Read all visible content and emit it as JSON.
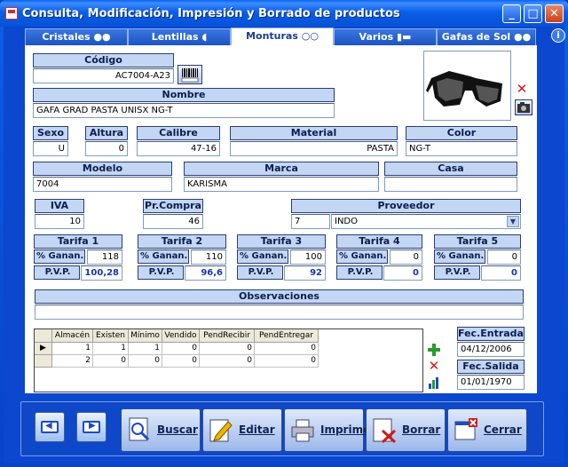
{
  "window": {
    "title": "Consulta, Modificación, Impresión y Borrado de productos"
  },
  "tabs": [
    {
      "label": "Cristales"
    },
    {
      "label": "Lentillas"
    },
    {
      "label": "Monturas"
    },
    {
      "label": "Varios"
    },
    {
      "label": "Gafas de Sol"
    }
  ],
  "help_label": "i",
  "product": {
    "codigo_label": "Código",
    "codigo": "AC7004-A23",
    "nombre_label": "Nombre",
    "nombre": "GAFA GRAD PASTA UNISX NG-T",
    "sexo_label": "Sexo",
    "sexo": "U",
    "altura_label": "Altura",
    "altura": "0",
    "calibre_label": "Calibre",
    "calibre": "47-16",
    "material_label": "Material",
    "material": "PASTA",
    "color_label": "Color",
    "color": "NG-T",
    "modelo_label": "Modelo",
    "modelo": "7004",
    "marca_label": "Marca",
    "marca": "KARISMA",
    "casa_label": "Casa",
    "casa": "",
    "iva_label": "IVA",
    "iva": "10",
    "prcompra_label": "Pr.Compra",
    "prcompra": "46",
    "proveedor_label": "Proveedor",
    "proveedor_code": "7",
    "proveedor_name": "INDO"
  },
  "tarifas": [
    {
      "label": "Tarifa 1",
      "ganan": "118",
      "pvp": "100,28"
    },
    {
      "label": "Tarifa 2",
      "ganan": "110",
      "pvp": "96,6"
    },
    {
      "label": "Tarifa 3",
      "ganan": "100",
      "pvp": "92"
    },
    {
      "label": "Tarifa 4",
      "ganan": "0",
      "pvp": "0"
    },
    {
      "label": "Tarifa 5",
      "ganan": "0",
      "pvp": "0"
    }
  ],
  "ganan_label": "% Ganan.",
  "pvp_label": "P.V.P.",
  "observaciones_label": "Observaciones",
  "observaciones": "",
  "stock": {
    "headers": [
      "Almacén",
      "Existen",
      "Mínimo",
      "Vendido",
      "PendRecibir",
      "PendEntregar"
    ],
    "rows": [
      [
        "1",
        "1",
        "1",
        "0",
        "0",
        "0"
      ],
      [
        "2",
        "0",
        "0",
        "0",
        "0",
        "0"
      ]
    ]
  },
  "fec_entrada_label": "Fec.Entrada",
  "fec_entrada": "04/12/2006",
  "fec_salida_label": "Fec.Salida",
  "fec_salida": "01/01/1970",
  "buttons": {
    "buscar": "Buscar",
    "editar": "Editar",
    "imprime": "Imprime",
    "borrar": "Borrar",
    "cerrar": "Cerrar"
  }
}
